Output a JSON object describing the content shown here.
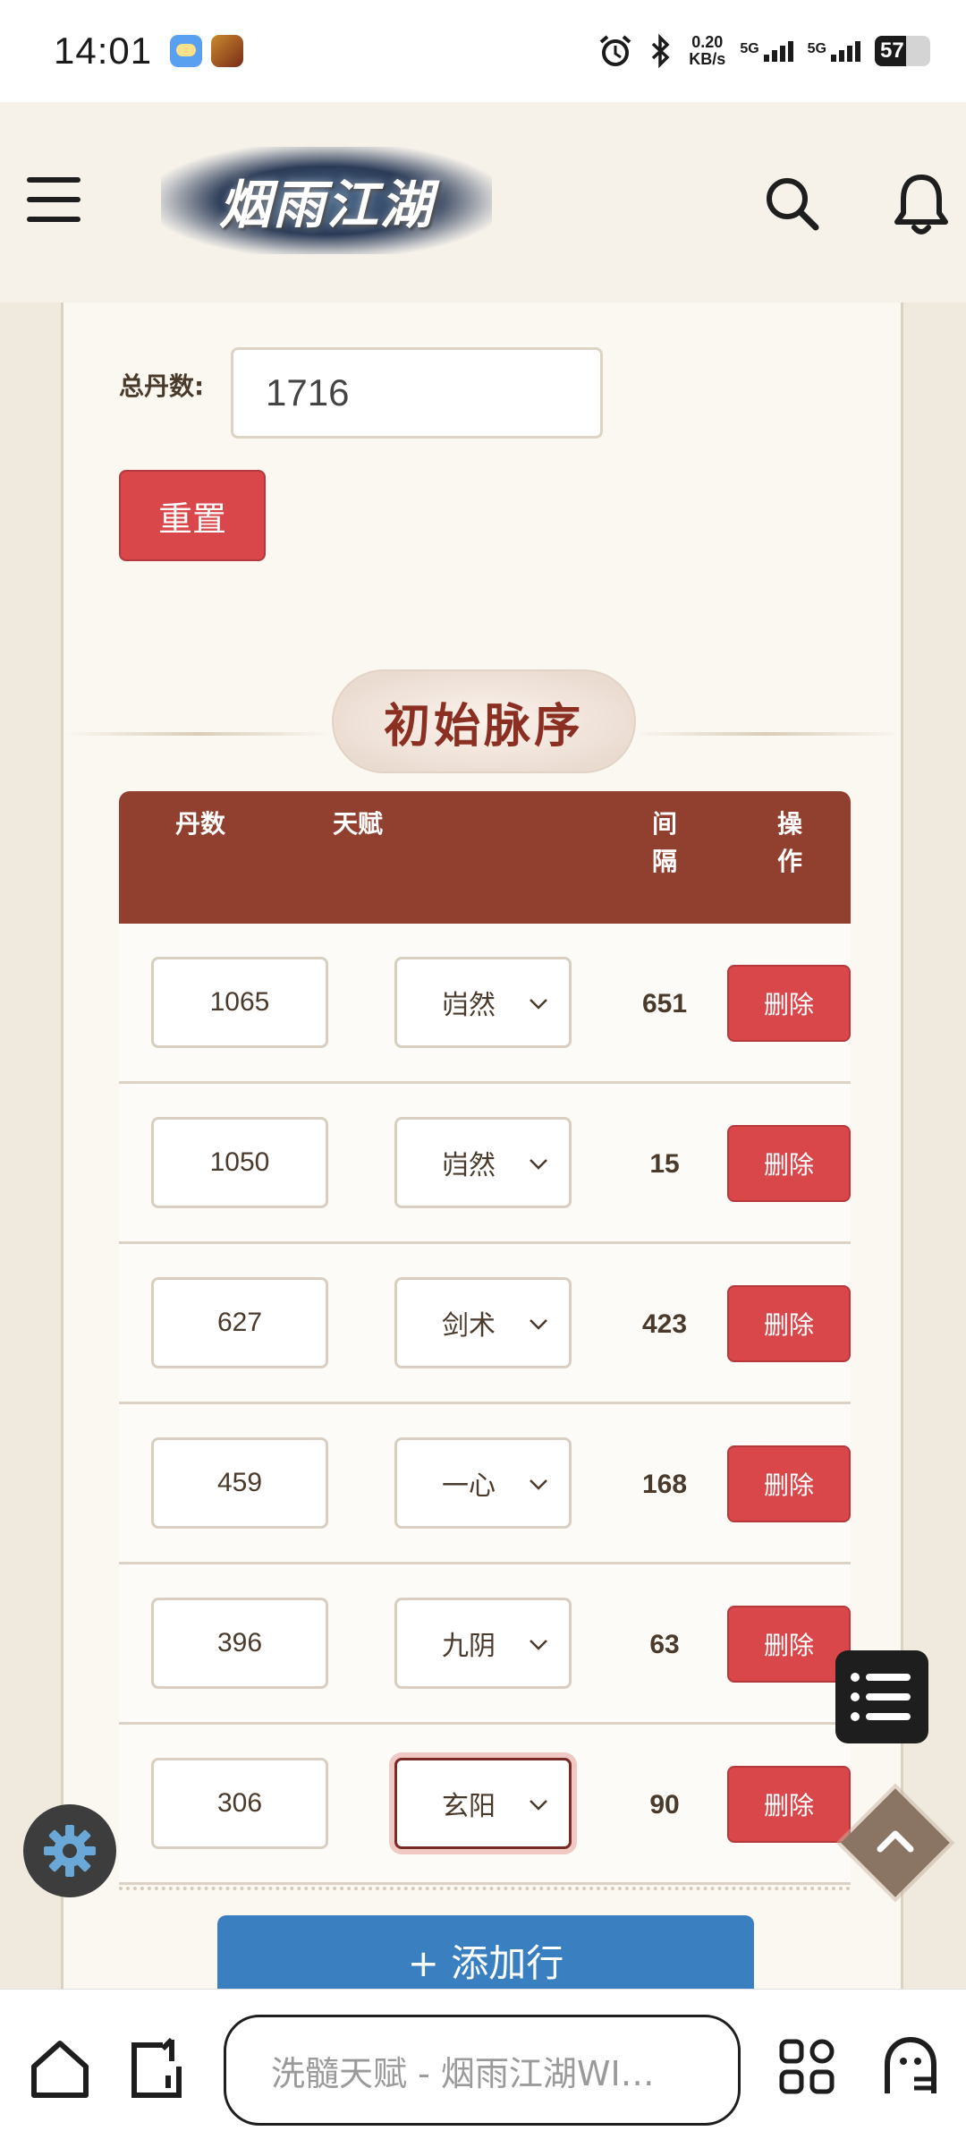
{
  "status_bar": {
    "time": "14:01",
    "speed_value": "0.20",
    "speed_unit": "KB/s",
    "net1": "5G",
    "net2": "5G",
    "battery": "57",
    "battery_level": 0.57
  },
  "header": {
    "logo_text": "烟雨江湖",
    "menu_icon": "hamburger-menu-icon",
    "search_icon": "search-icon",
    "bell_icon": "bell-icon"
  },
  "form": {
    "total_label": "总丹数:",
    "total_value": "1716",
    "reset_label": "重置"
  },
  "section": {
    "title": "初始脉序"
  },
  "table": {
    "headers": [
      "丹数",
      "天赋",
      "间\n隔",
      "操\n作"
    ],
    "delete_label": "删除",
    "rows": [
      {
        "dan": "1065",
        "talent": "岿然",
        "gap": "651"
      },
      {
        "dan": "1050",
        "talent": "岿然",
        "gap": "15"
      },
      {
        "dan": "627",
        "talent": "剑术",
        "gap": "423"
      },
      {
        "dan": "459",
        "talent": "一心",
        "gap": "168"
      },
      {
        "dan": "396",
        "talent": "九阴",
        "gap": "63"
      },
      {
        "dan": "306",
        "talent": "玄阳",
        "gap": "90"
      }
    ],
    "add_label": "+ 添加行"
  },
  "bottom_nav": {
    "url_text": "洗髓天赋 - 烟雨江湖WI…"
  },
  "colors": {
    "accent_red": "#d9474a",
    "header_brown": "#913f2e",
    "add_blue": "#3a7fc0"
  }
}
